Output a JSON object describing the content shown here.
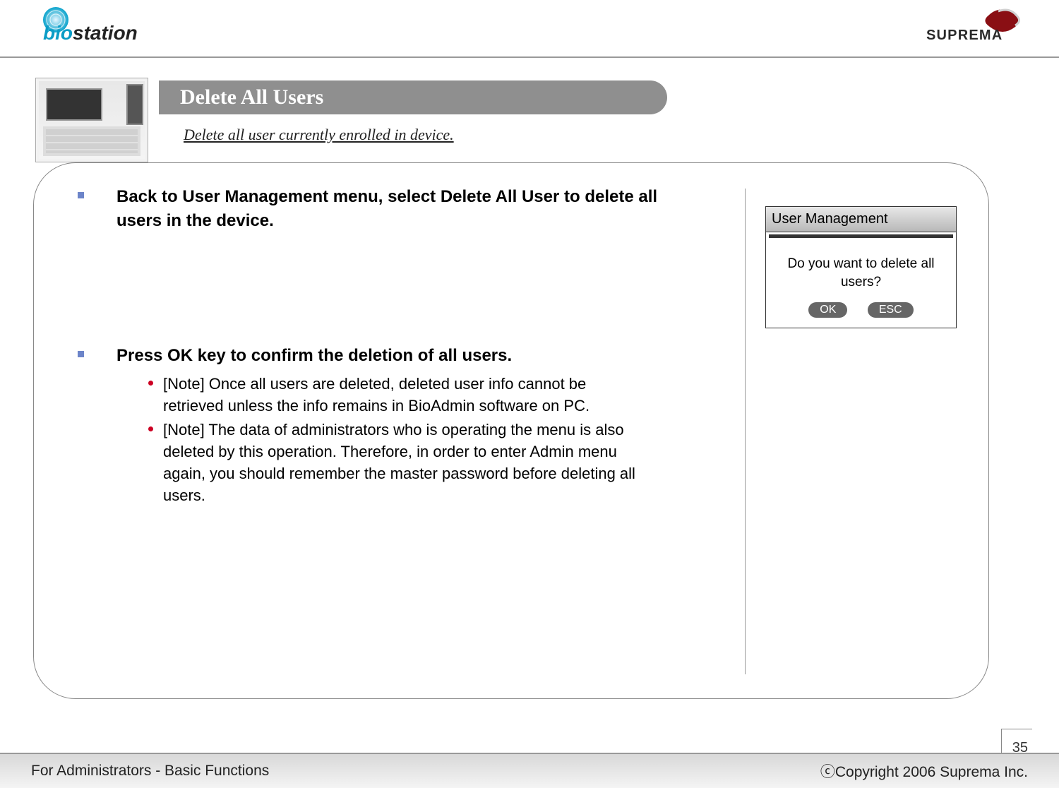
{
  "logos": {
    "biostation": "biostation",
    "suprema": "SUPREMA"
  },
  "title": "Delete All Users",
  "subtitle": "Delete all user currently enrolled in device.",
  "bullets": {
    "b1": "Back to User Management menu, select Delete All User to delete all users in the device.",
    "b2": "Press OK key to confirm the deletion of all users.",
    "sub1": "[Note] Once all users are deleted, deleted user info cannot be retrieved unless the info remains in BioAdmin software on PC.",
    "sub2": "[Note] The data of administrators who is operating the menu is also deleted by this operation. Therefore, in order to enter Admin menu again, you should remember the master password before deleting all users."
  },
  "screen": {
    "title": "User Management",
    "msg": "Do you want to delete all users?",
    "ok": "OK",
    "esc": "ESC"
  },
  "pageNumber": "35",
  "footer": {
    "left": "For Administrators - Basic Functions",
    "right": "ⓒCopyright 2006 Suprema Inc."
  }
}
